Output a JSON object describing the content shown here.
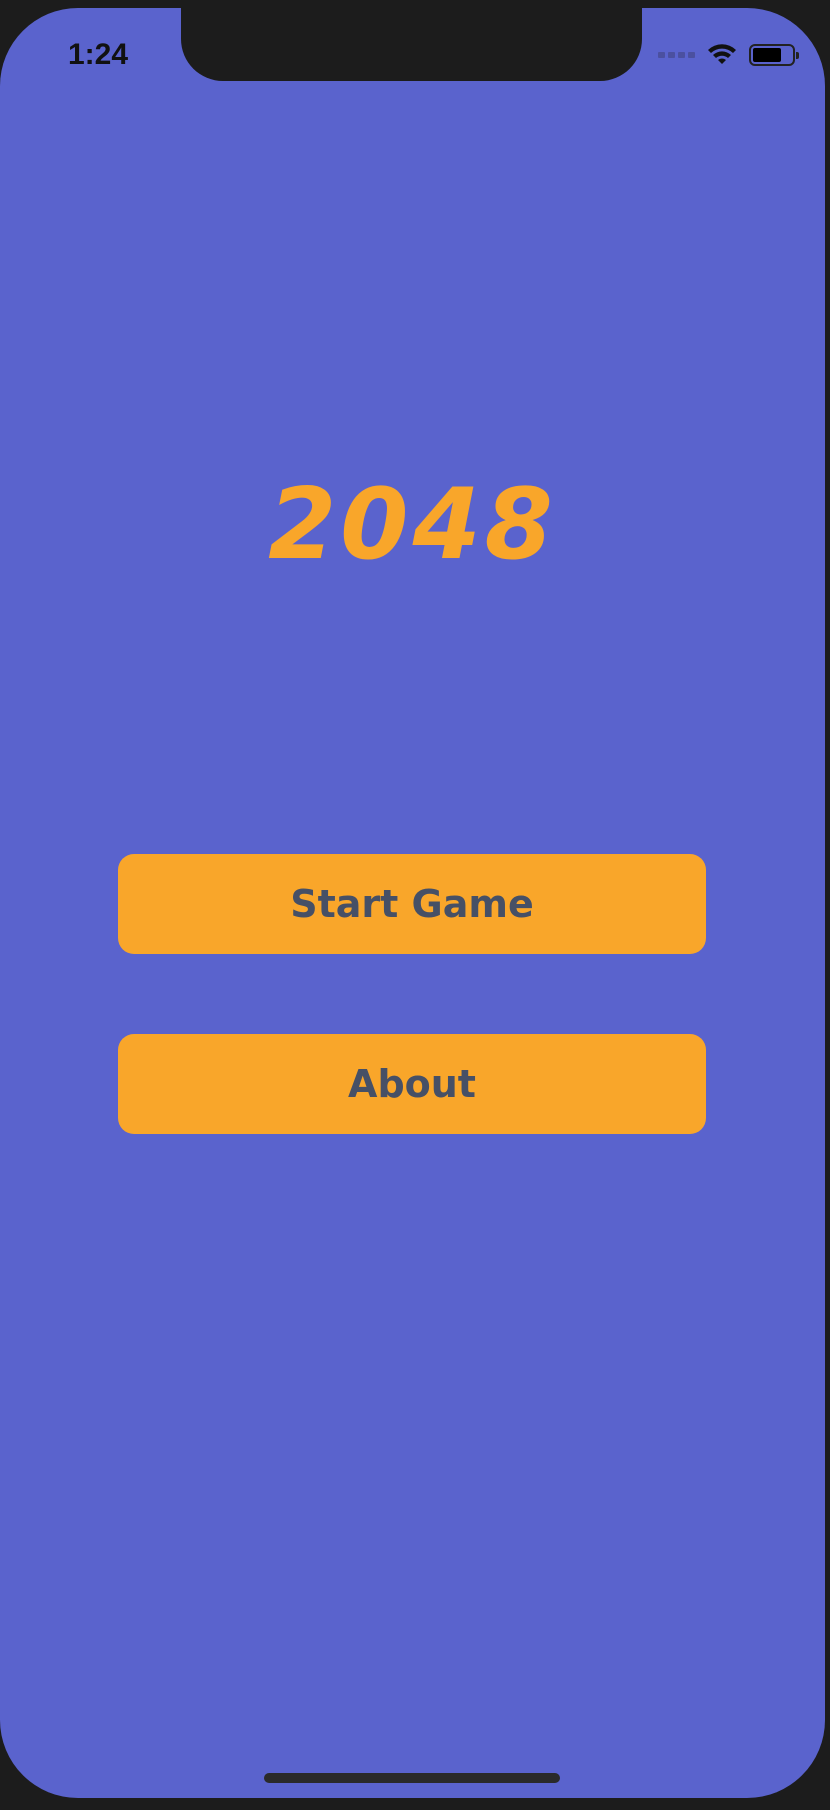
{
  "status_bar": {
    "time": "1:24",
    "icons": [
      "cellular-signal-icon",
      "wifi-icon",
      "battery-icon"
    ]
  },
  "home": {
    "title": "2048",
    "start_label": "Start Game",
    "about_label": "About"
  },
  "colors": {
    "background": "#5a63cd",
    "accent": "#f9a62a",
    "button_text": "#465066"
  }
}
